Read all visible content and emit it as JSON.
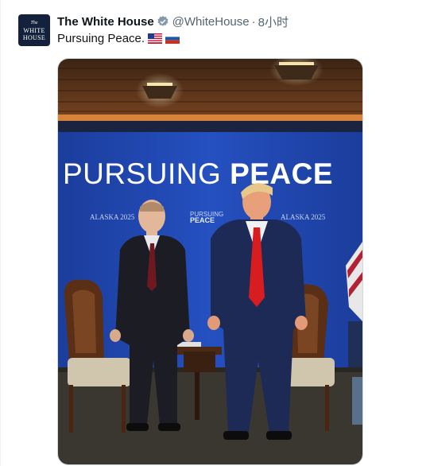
{
  "tweet": {
    "avatar": {
      "line1": "The",
      "line2": "WHITE",
      "line3": "HOUSE"
    },
    "display_name": "The White House",
    "handle": "@WhiteHouse",
    "separator": "·",
    "timestamp": "8小时",
    "text": "Pursuing Peace.",
    "emojis": [
      "us-flag-icon",
      "russia-flag-icon"
    ]
  },
  "photo": {
    "banner_main_light": "PURSUING ",
    "banner_main_bold": "PEACE",
    "small_left": "ALASKA 2025",
    "small_center_1": "PURSUING",
    "small_center_2": "PEACE",
    "small_right": "ALASKA 2025",
    "colors": {
      "backdrop_blue": "#1f44a8",
      "ceiling_wood": "#6b3a1c",
      "floor": "#3a3630",
      "verified_blue": "#1d9bf0"
    }
  }
}
